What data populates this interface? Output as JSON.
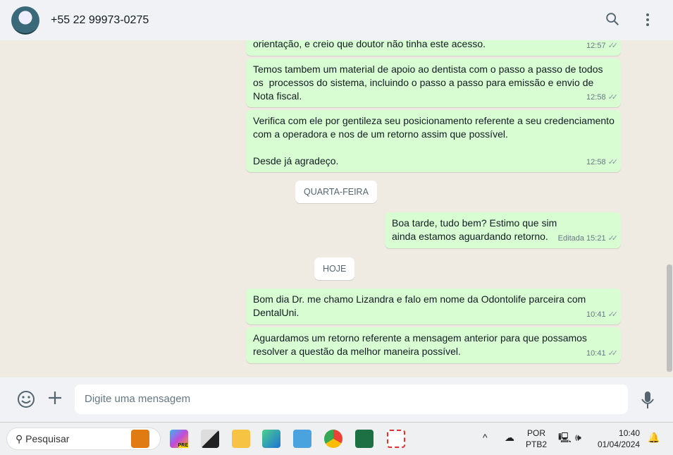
{
  "header": {
    "contact": "+55 22 99973-0275"
  },
  "messages": [
    {
      "text": "orientação, e creio que doutor não tinha este acesso.",
      "time": "12:57"
    },
    {
      "text": "Temos tambem um material de apoio ao dentista com o passo a passo de todos os  processos do sistema, incluindo o passo a passo para emissão e envio de Nota fiscal.",
      "time": "12:58"
    },
    {
      "text": "Verifica com ele por gentileza seu posicionamento referente a seu credenciamento com a operadora e nos de um retorno assim que possível.\n\nDesde já agradeço.",
      "time": "12:58"
    },
    {
      "text": "Boa tarde, tudo bem? Estimo que sim ainda estamos aguardando retorno.",
      "time": "Editada 15:21"
    },
    {
      "text": "Bom dia Dr. me chamo Lizandra e falo em nome da Odontolife parceira com DentalUni.",
      "time": "10:41"
    },
    {
      "text": "Aguardamos um retorno referente a mensagem anterior para que possamos resolver a questão da melhor maneira possível.",
      "time": "10:41"
    }
  ],
  "dates": [
    "QUARTA-FEIRA",
    "HOJE"
  ],
  "composer": {
    "placeholder": "Digite uma mensagem"
  },
  "taskbar": {
    "search": "Pesquisar",
    "lang1": "POR",
    "lang2": "PTB2",
    "time": "10:40",
    "date": "01/04/2024",
    "copilot_badge": "PRE"
  }
}
